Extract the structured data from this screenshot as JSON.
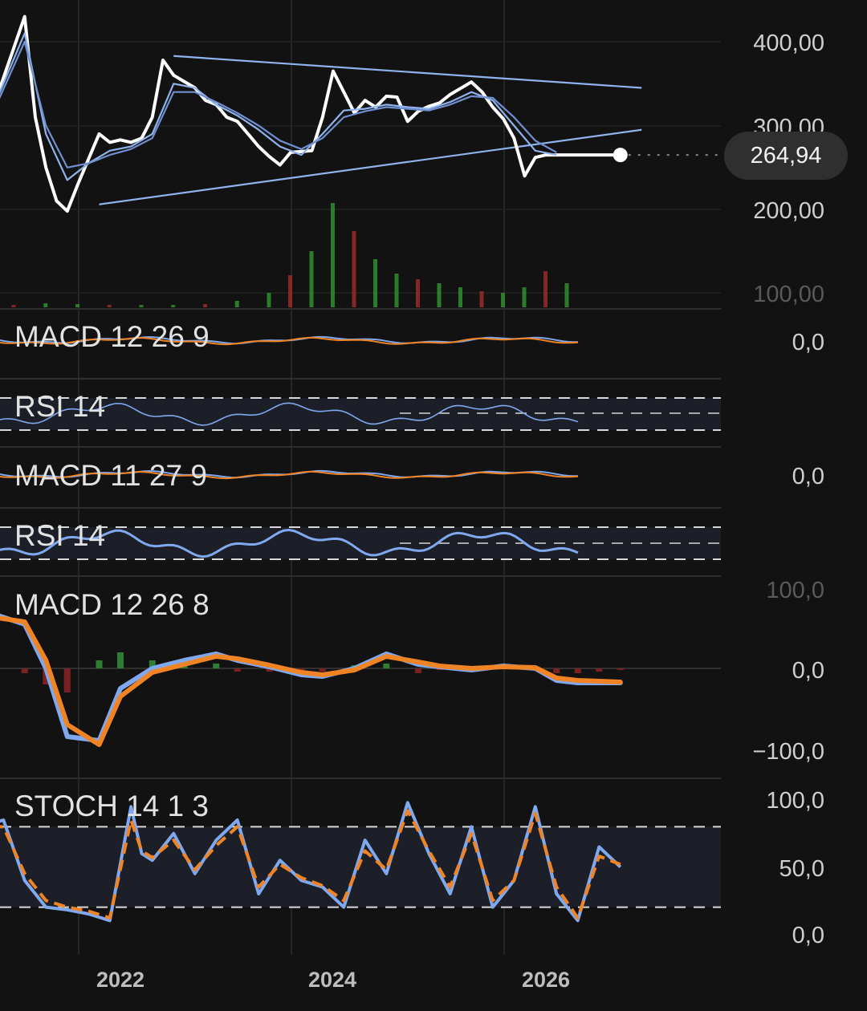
{
  "price_badge": "264,94",
  "chart_data": [
    {
      "type": "line",
      "panel": "price",
      "title": "",
      "y_ticks": [
        "400,00",
        "300,00",
        "200,00",
        "100,00"
      ],
      "ylim": [
        100,
        420
      ],
      "last_value": 264.94,
      "series": [
        {
          "name": "",
          "color": "#ffffff",
          "x": [
            2020.8,
            2021.1,
            2021.2,
            2021.3,
            2021.4,
            2021.5,
            2021.6,
            2021.8,
            2021.9,
            2022.0,
            2022.1,
            2022.2,
            2022.3,
            2022.4,
            2022.5,
            2022.7,
            2022.8,
            2022.9,
            2023.0,
            2023.1,
            2023.2,
            2023.3,
            2023.4,
            2023.5,
            2023.6,
            2023.8,
            2023.9,
            2024.0,
            2024.2,
            2024.3,
            2024.4,
            2024.5,
            2024.6,
            2024.7,
            2024.8,
            2024.9,
            2025.0,
            2025.1,
            2025.3,
            2025.4,
            2025.5,
            2025.6,
            2025.7,
            2025.8,
            2025.9,
            2026.0,
            2026.1,
            2026.2,
            2026.3,
            2026.4,
            2026.5,
            2026.6,
            2026.7
          ],
          "values": [
            320,
            430,
            310,
            250,
            210,
            198,
            230,
            290,
            280,
            283,
            280,
            285,
            310,
            378,
            360,
            345,
            330,
            325,
            310,
            305,
            290,
            275,
            263,
            253,
            268,
            270,
            310,
            365,
            315,
            330,
            322,
            335,
            334,
            305,
            317,
            323,
            327,
            337,
            352,
            340,
            322,
            308,
            285,
            240,
            262,
            265,
            264.94,
            264.94,
            264.94,
            264.94,
            264.94,
            264.94,
            264.94
          ]
        },
        {
          "name": "",
          "color": "#8fb3ec",
          "x": [
            2020.8,
            2021.1,
            2021.3,
            2021.5,
            2021.7,
            2021.9,
            2022.1,
            2022.3,
            2022.5,
            2022.7,
            2022.9,
            2023.1,
            2023.3,
            2023.5,
            2023.7,
            2023.9,
            2024.1,
            2024.3,
            2024.5,
            2024.7,
            2024.9,
            2025.1,
            2025.3,
            2025.5,
            2025.7,
            2025.9,
            2026.1
          ],
          "values": [
            320,
            410,
            290,
            235,
            255,
            270,
            275,
            290,
            350,
            345,
            325,
            312,
            295,
            275,
            265,
            290,
            318,
            320,
            325,
            322,
            320,
            328,
            340,
            330,
            300,
            270,
            265
          ]
        },
        {
          "name": "",
          "color": "#6f8fd0",
          "x": [
            2020.8,
            2021.1,
            2021.3,
            2021.5,
            2021.7,
            2021.9,
            2022.1,
            2022.3,
            2022.5,
            2022.7,
            2022.9,
            2023.1,
            2023.3,
            2023.5,
            2023.7,
            2023.9,
            2024.1,
            2024.3,
            2024.5,
            2024.7,
            2024.9,
            2025.1,
            2025.3,
            2025.5,
            2025.7,
            2025.9,
            2026.1
          ],
          "values": [
            315,
            400,
            300,
            250,
            255,
            265,
            272,
            285,
            340,
            340,
            328,
            315,
            300,
            282,
            272,
            285,
            310,
            317,
            322,
            320,
            318,
            325,
            335,
            333,
            310,
            282,
            268
          ]
        }
      ],
      "trendlines": [
        {
          "x": [
            2021.8,
            2026.9
          ],
          "values": [
            206,
            295
          ],
          "color": "#8fb3ec"
        },
        {
          "x": [
            2022.5,
            2026.9
          ],
          "values": [
            383,
            345
          ],
          "color": "#8fb3ec"
        }
      ],
      "volume": {
        "x": [
          2021.0,
          2021.3,
          2021.6,
          2021.9,
          2022.2,
          2022.5,
          2022.8,
          2023.1,
          2023.4,
          2023.6,
          2023.8,
          2024.0,
          2024.2,
          2024.4,
          2024.6,
          2024.8,
          2025.0,
          2025.2,
          2025.4,
          2025.6,
          2025.8,
          2026.0,
          2026.2
        ],
        "values": [
          3,
          5,
          4,
          3,
          3,
          3,
          4,
          8,
          18,
          40,
          70,
          130,
          95,
          60,
          42,
          35,
          30,
          25,
          20,
          18,
          25,
          45,
          30
        ]
      }
    },
    {
      "type": "line",
      "panel": "macd1",
      "label": "MACD 12 26 9",
      "y_ticks": [
        "0,0"
      ]
    },
    {
      "type": "line",
      "panel": "rsi1",
      "label": "RSI 14"
    },
    {
      "type": "line",
      "panel": "macd2",
      "label": "MACD 11 27 9",
      "y_ticks": [
        "0,0"
      ]
    },
    {
      "type": "line",
      "panel": "rsi2",
      "label": "RSI 14"
    },
    {
      "type": "line",
      "panel": "macd3",
      "label": "MACD 12 26 8",
      "y_ticks": [
        "100,0",
        "0,0",
        "−100,0"
      ],
      "ylim": [
        -110,
        100
      ],
      "series": [
        {
          "name": "",
          "color": "#7fa8ee",
          "x": [
            2020.3,
            2020.8,
            2021.1,
            2021.3,
            2021.5,
            2021.8,
            2022.0,
            2022.3,
            2022.6,
            2022.9,
            2023.1,
            2023.4,
            2023.7,
            2023.9,
            2024.2,
            2024.5,
            2024.8,
            2025.0,
            2025.3,
            2025.6,
            2025.9,
            2026.1,
            2026.3,
            2026.5,
            2026.7
          ],
          "values": [
            55,
            68,
            55,
            0,
            -85,
            -90,
            -25,
            0,
            10,
            18,
            10,
            2,
            -8,
            -10,
            0,
            18,
            5,
            2,
            -2,
            3,
            0,
            -15,
            -18,
            -18,
            -18
          ]
        },
        {
          "name": "",
          "color": "#f08424",
          "x": [
            2020.3,
            2020.8,
            2021.1,
            2021.3,
            2021.5,
            2021.8,
            2022.0,
            2022.3,
            2022.6,
            2022.9,
            2023.1,
            2023.4,
            2023.7,
            2023.9,
            2024.2,
            2024.5,
            2024.8,
            2025.0,
            2025.3,
            2025.6,
            2025.9,
            2026.1,
            2026.3,
            2026.5,
            2026.7
          ],
          "values": [
            55,
            64,
            58,
            10,
            -70,
            -95,
            -35,
            -5,
            5,
            15,
            12,
            4,
            -5,
            -8,
            -2,
            15,
            8,
            3,
            0,
            2,
            1,
            -12,
            -15,
            -16,
            -17
          ]
        }
      ]
    },
    {
      "type": "line",
      "panel": "stoch",
      "label": "STOCH 14 1 3",
      "y_ticks": [
        "100,0",
        "50,0",
        "0,0"
      ],
      "ylim": [
        0,
        100
      ],
      "series": [
        {
          "name": "",
          "color": "#7fa8ee",
          "x": [
            2020.3,
            2020.6,
            2020.9,
            2021.1,
            2021.3,
            2021.5,
            2021.7,
            2021.9,
            2022.1,
            2022.2,
            2022.3,
            2022.5,
            2022.7,
            2022.9,
            2023.1,
            2023.3,
            2023.5,
            2023.7,
            2023.9,
            2024.1,
            2024.3,
            2024.5,
            2024.7,
            2024.9,
            2025.1,
            2025.3,
            2025.5,
            2025.7,
            2025.9,
            2026.1,
            2026.3,
            2026.5,
            2026.7
          ],
          "values": [
            90,
            78,
            85,
            40,
            20,
            18,
            15,
            10,
            95,
            60,
            55,
            75,
            45,
            70,
            85,
            30,
            55,
            40,
            35,
            20,
            70,
            45,
            98,
            60,
            30,
            80,
            20,
            40,
            95,
            30,
            10,
            65,
            50
          ]
        },
        {
          "name": "",
          "color": "#f08424",
          "x": [
            2020.3,
            2020.6,
            2020.9,
            2021.1,
            2021.3,
            2021.5,
            2021.7,
            2021.9,
            2022.1,
            2022.2,
            2022.3,
            2022.5,
            2022.7,
            2022.9,
            2023.1,
            2023.3,
            2023.5,
            2023.7,
            2023.9,
            2024.1,
            2024.3,
            2024.5,
            2024.7,
            2024.9,
            2025.1,
            2025.3,
            2025.5,
            2025.7,
            2025.9,
            2026.1,
            2026.3,
            2026.5,
            2026.7
          ],
          "values": [
            85,
            80,
            80,
            45,
            25,
            20,
            17,
            12,
            85,
            62,
            57,
            70,
            48,
            66,
            80,
            35,
            52,
            42,
            36,
            25,
            62,
            48,
            92,
            62,
            35,
            75,
            25,
            40,
            90,
            35,
            12,
            58,
            52
          ]
        }
      ]
    }
  ],
  "x_axis": {
    "ticks": [
      "2022",
      "2024",
      "2026"
    ]
  }
}
